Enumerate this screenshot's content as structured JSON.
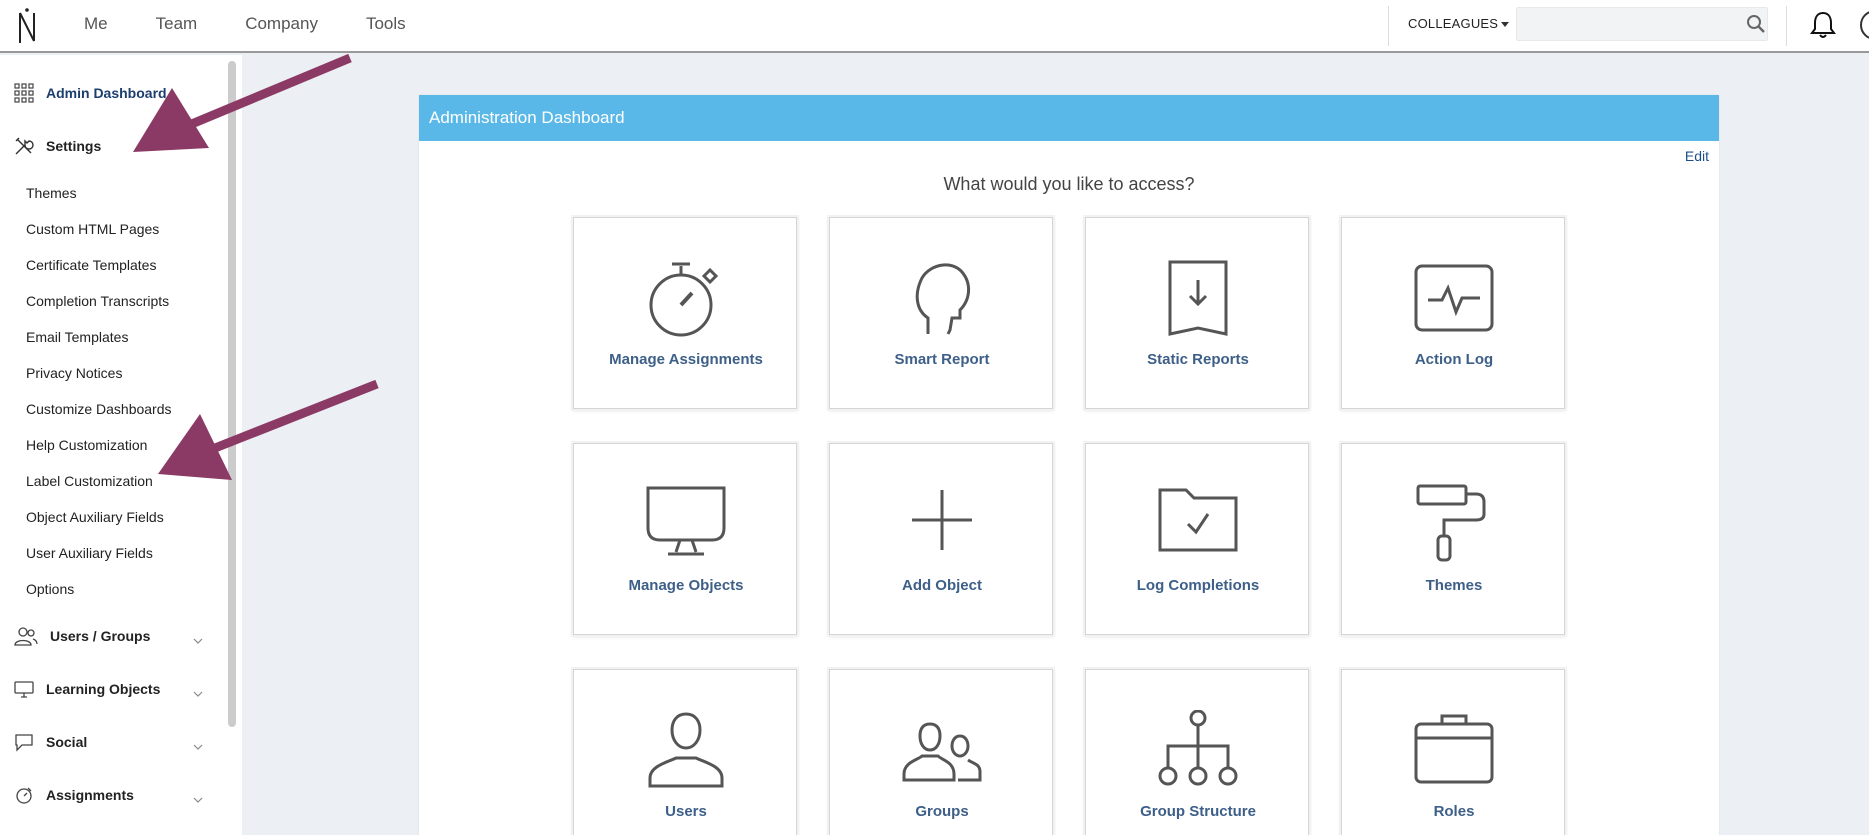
{
  "topbar": {
    "nav": [
      "Me",
      "Team",
      "Company",
      "Tools"
    ],
    "colleagues_label": "COLLEAGUES",
    "search_value": ""
  },
  "sidebar": {
    "admin_dashboard": "Admin Dashboard",
    "settings": "Settings",
    "settings_items": [
      "Themes",
      "Custom HTML Pages",
      "Certificate Templates",
      "Completion Transcripts",
      "Email Templates",
      "Privacy Notices",
      "Customize Dashboards",
      "Help Customization",
      "Label Customization",
      "Object Auxiliary Fields",
      "User Auxiliary Fields",
      "Options"
    ],
    "users_groups": "Users / Groups",
    "learning_objects": "Learning Objects",
    "social": "Social",
    "assignments": "Assignments"
  },
  "panel": {
    "title": "Administration Dashboard",
    "edit": "Edit",
    "question": "What would you like to access?",
    "tiles": [
      {
        "label": "Manage Assignments",
        "icon": "stopwatch-icon"
      },
      {
        "label": "Smart Report",
        "icon": "head-profile-icon"
      },
      {
        "label": "Static Reports",
        "icon": "download-document-icon"
      },
      {
        "label": "Action Log",
        "icon": "pulse-monitor-icon"
      },
      {
        "label": "Manage Objects",
        "icon": "monitor-icon"
      },
      {
        "label": "Add Object",
        "icon": "plus-icon"
      },
      {
        "label": "Log Completions",
        "icon": "folder-check-icon"
      },
      {
        "label": "Themes",
        "icon": "paint-roller-icon"
      },
      {
        "label": "Users",
        "icon": "user-icon"
      },
      {
        "label": "Groups",
        "icon": "group-icon"
      },
      {
        "label": "Group Structure",
        "icon": "org-chart-icon"
      },
      {
        "label": "Roles",
        "icon": "briefcase-icon"
      }
    ]
  },
  "colors": {
    "header_blue": "#5ab8e8",
    "link_blue": "#3d5f88",
    "arrow_purple": "#8b3a66"
  }
}
